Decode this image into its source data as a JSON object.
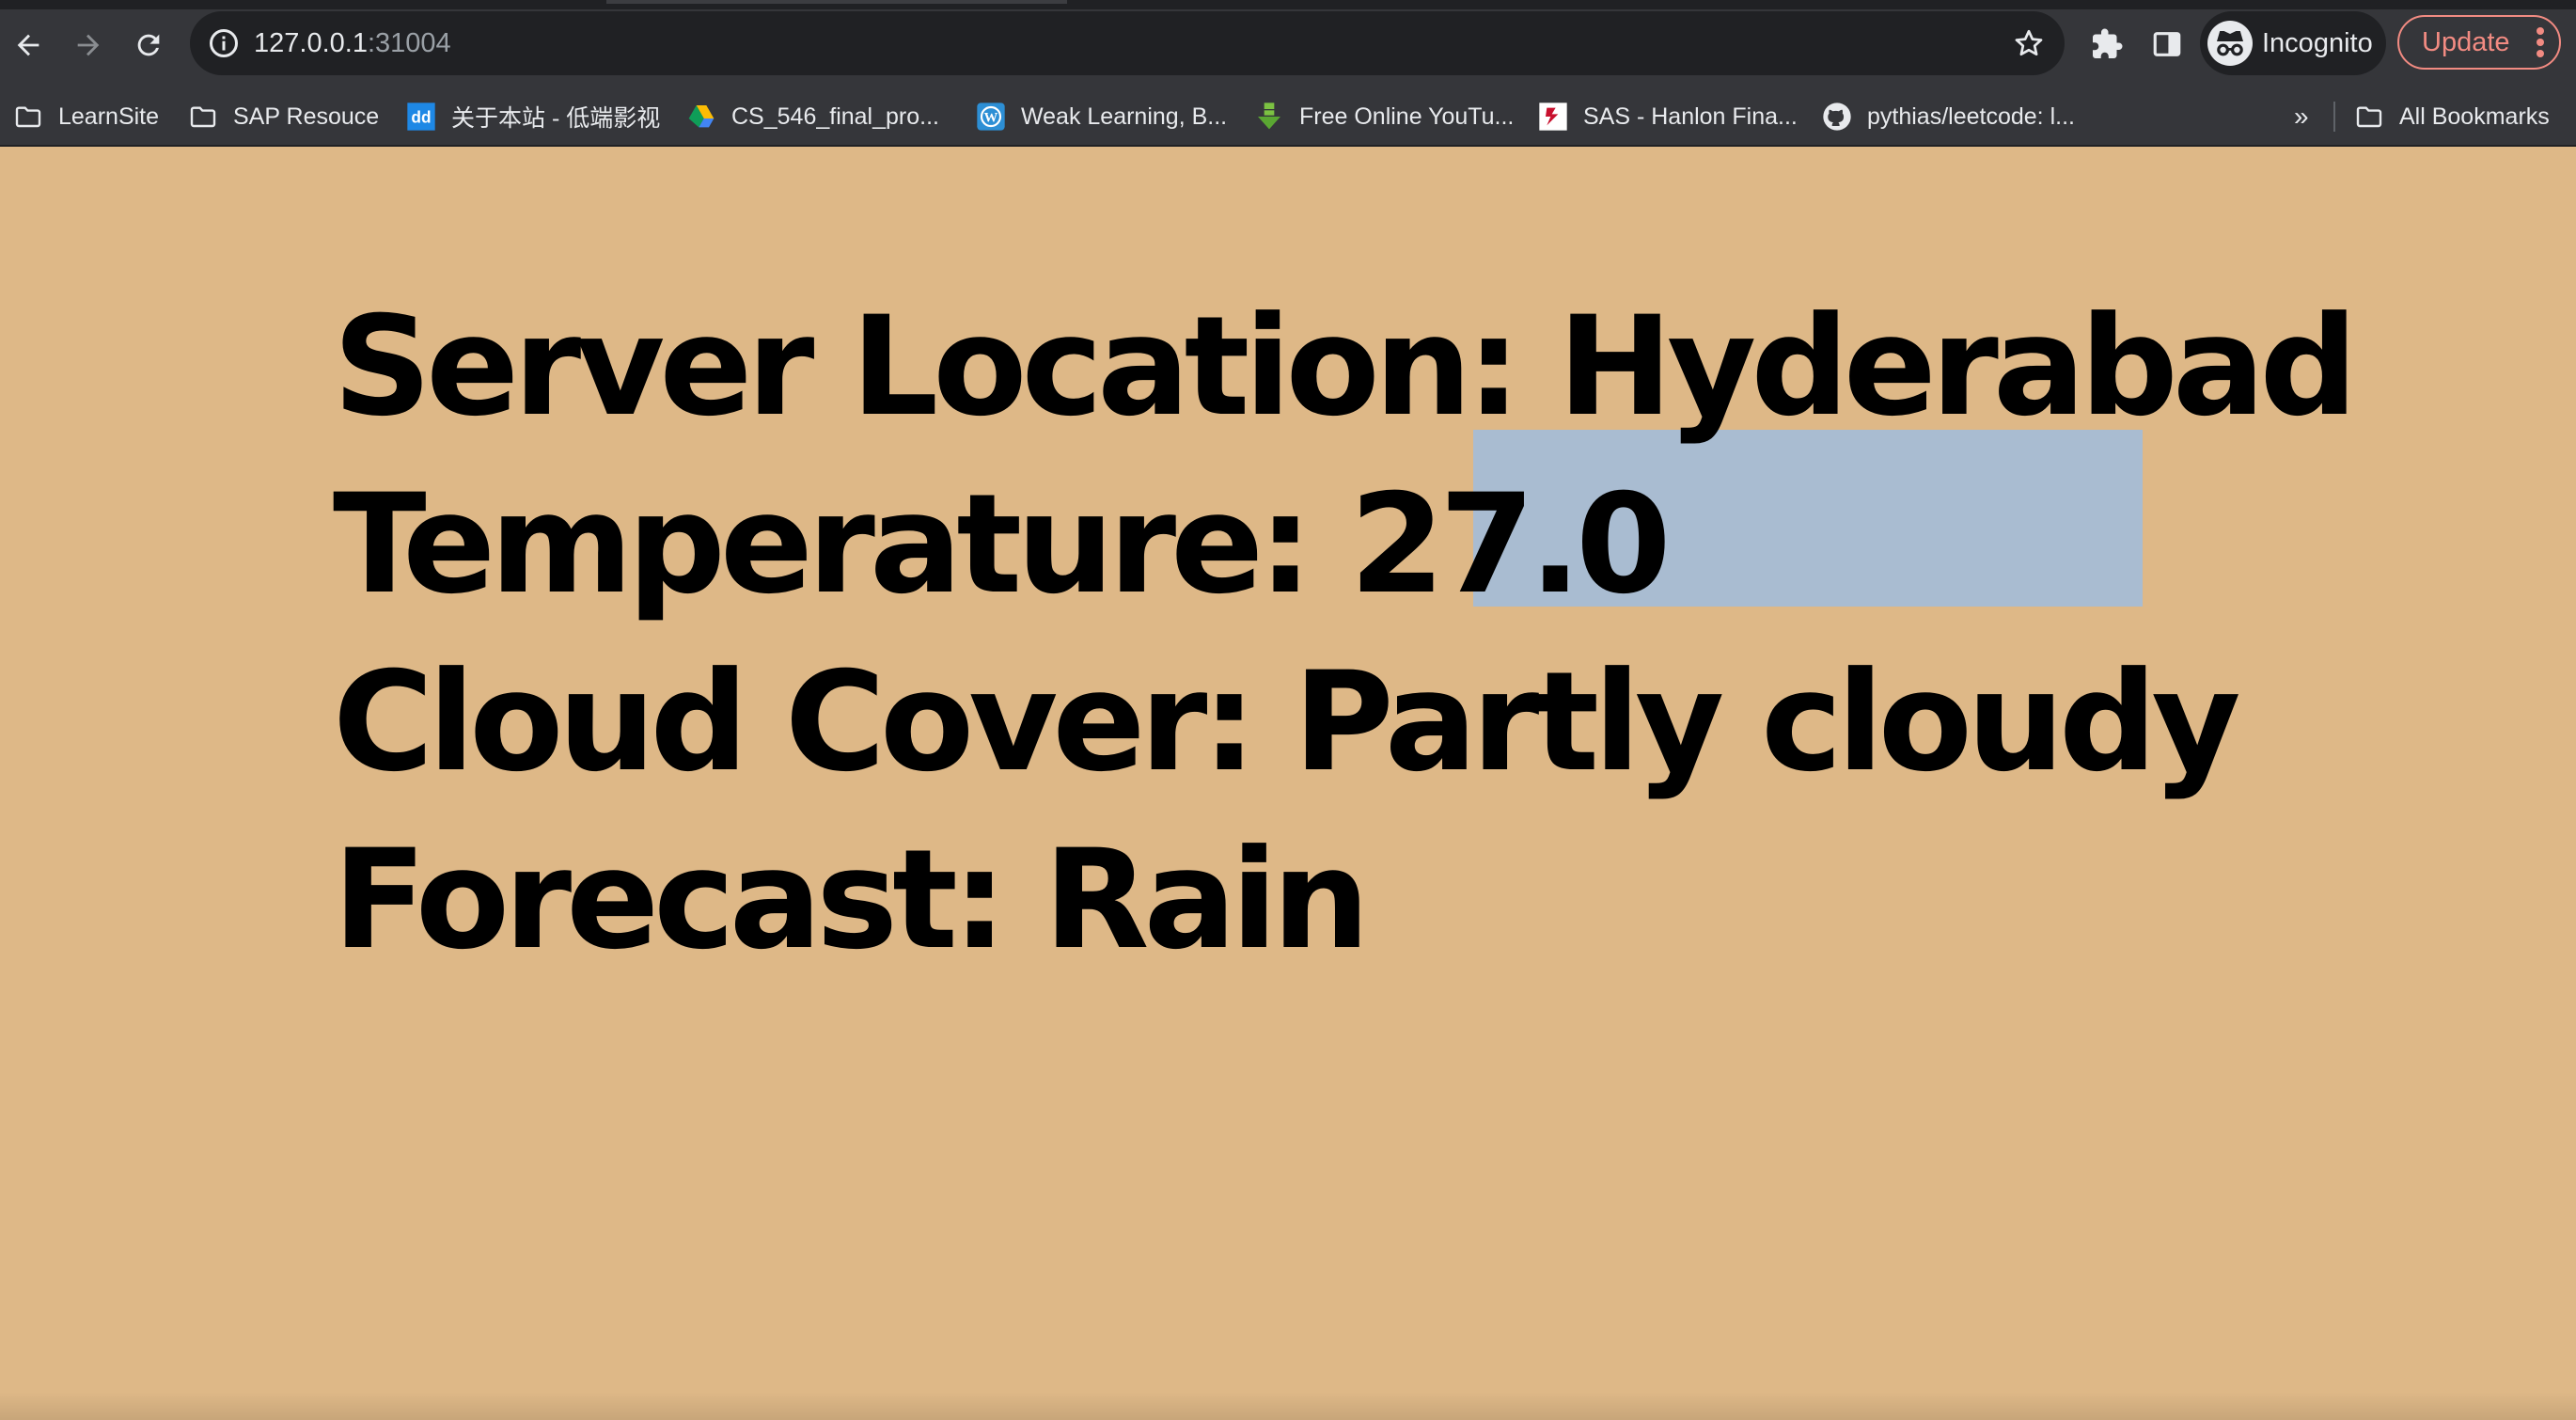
{
  "browser": {
    "url_host": "127.0.0.1",
    "url_port": ":31004",
    "profile_label": "Incognito",
    "update_label": "Update",
    "bookmarks": [
      {
        "label": "LearnSite",
        "icon": "folder-icon"
      },
      {
        "label": "SAP Resouce",
        "icon": "folder-icon"
      },
      {
        "label": "关于本站 - 低端影视",
        "icon": "site-favicon-dd"
      },
      {
        "label": "CS_546_final_pro...",
        "icon": "google-drive-icon"
      },
      {
        "label": "Weak Learning, B...",
        "icon": "wordpress-icon"
      },
      {
        "label": "Free Online YouTu...",
        "icon": "download-arrow-icon"
      },
      {
        "label": "SAS - Hanlon Fina...",
        "icon": "sas-favicon"
      },
      {
        "label": "pythias/leetcode: l...",
        "icon": "github-icon"
      }
    ],
    "bookmarks_overflow": "»",
    "all_bookmarks_label": "All Bookmarks"
  },
  "weather": {
    "location_label": "Server Location:",
    "location_value": "Hyderabad",
    "temperature_label": "Temperature:",
    "temperature_value": "27.0",
    "cloud_label": "Cloud Cover:",
    "cloud_value": "Partly cloudy",
    "forecast_label": "Forecast:",
    "forecast_value": "Rain"
  },
  "colors": {
    "page_background": "#deb887",
    "text": "#000000",
    "selection": "#a9bcd1",
    "chrome_toolbar": "#35363a",
    "update_accent": "#f28b82"
  }
}
